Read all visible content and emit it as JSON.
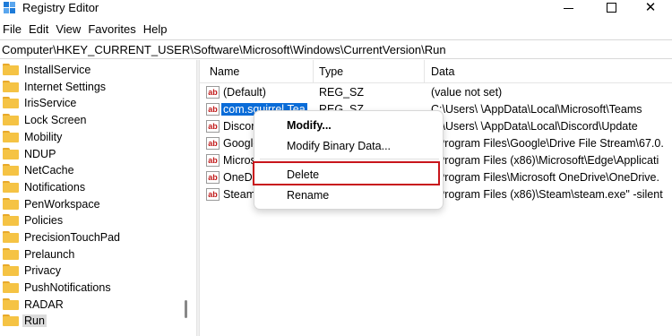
{
  "window": {
    "title": "Registry Editor",
    "minimize_icon": "minimize-icon",
    "maximize_icon": "maximize-icon",
    "close_icon": "close-icon",
    "close_glyph": "✕"
  },
  "menu": [
    {
      "label": "File"
    },
    {
      "label": "Edit"
    },
    {
      "label": "View"
    },
    {
      "label": "Favorites"
    },
    {
      "label": "Help"
    }
  ],
  "address": "Computer\\HKEY_CURRENT_USER\\Software\\Microsoft\\Windows\\CurrentVersion\\Run",
  "tree": {
    "items": [
      {
        "label": "InstallService"
      },
      {
        "label": "Internet Settings"
      },
      {
        "label": "IrisService"
      },
      {
        "label": "Lock Screen"
      },
      {
        "label": "Mobility"
      },
      {
        "label": "NDUP"
      },
      {
        "label": "NetCache"
      },
      {
        "label": "Notifications"
      },
      {
        "label": "PenWorkspace"
      },
      {
        "label": "Policies"
      },
      {
        "label": "PrecisionTouchPad"
      },
      {
        "label": "Prelaunch"
      },
      {
        "label": "Privacy"
      },
      {
        "label": "PushNotifications"
      },
      {
        "label": "RADAR"
      },
      {
        "label": "Run"
      }
    ],
    "selected": "Run"
  },
  "values_table": {
    "columns": [
      "Name",
      "Type",
      "Data"
    ],
    "value_icon_text": "ab",
    "rows": [
      {
        "name": "(Default)",
        "type": "REG_SZ",
        "data": "(value not set)"
      },
      {
        "name": "com.squirrel.Tea",
        "type": "REG_SZ",
        "data": "C:\\Users\\         \\AppData\\Local\\Microsoft\\Teams"
      },
      {
        "name": "Discor",
        "type": "",
        "data": "C:\\Users\\         \\AppData\\Local\\Discord\\Update"
      },
      {
        "name": "Google",
        "type": "",
        "data": ":\\Program Files\\Google\\Drive File Stream\\67.0."
      },
      {
        "name": "Micros",
        "type": "",
        "data": ":\\Program Files (x86)\\Microsoft\\Edge\\Applicati"
      },
      {
        "name": "OneD",
        "type": "",
        "data": ":\\Program Files\\Microsoft OneDrive\\OneDrive."
      },
      {
        "name": "Steam",
        "type": "",
        "data": ":\\Program Files (x86)\\Steam\\steam.exe\" -silent"
      }
    ],
    "selected_row": "com.squirrel.Tea"
  },
  "context_menu": {
    "items": [
      {
        "label": "Modify...",
        "bold": true
      },
      {
        "label": "Modify Binary Data..."
      },
      {
        "label": "Delete",
        "highlighted": true
      },
      {
        "label": "Rename"
      }
    ]
  },
  "colors": {
    "selection": "#0a6cd8",
    "highlight_box": "#c8151b",
    "folder": "#f5c344"
  }
}
